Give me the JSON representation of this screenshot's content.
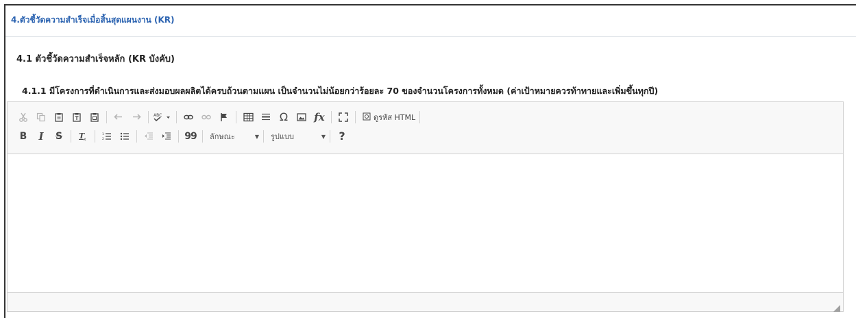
{
  "section": {
    "title": "4.ตัวชี้วัดความสำเร็จเมื่อสิ้นสุดแผนงาน (KR)",
    "subtitle": "4.1 ตัวชี้วัดความสำเร็จหลัก (KR บังคับ)",
    "kr_title": "4.1.1 มีโครงการที่ดำเนินการและส่งมอบผลผลิตได้ครบถ้วนตามแผน เป็นจำนวนไม่น้อยกว่าร้อยละ 70 ของจำนวนโครงการทั้งหมด (ค่าเป้าหมายควรท้าทายและเพิ่มขึ้นทุกปี)"
  },
  "toolbar": {
    "source_label": "ดูรหัส HTML",
    "styles_label": "ลักษณะ",
    "format_label": "รูปแบบ",
    "help_label": "?",
    "italic_label": "I",
    "strike_label": "S",
    "blockquote_label": "99",
    "formula_label": "fx",
    "omega_label": "Ω",
    "bold_label": "B"
  },
  "editor": {
    "content": ""
  },
  "colors": {
    "accent": "#2a62b0",
    "toolbar_bg": "#f8f8f8",
    "border": "#d1d1d1"
  }
}
